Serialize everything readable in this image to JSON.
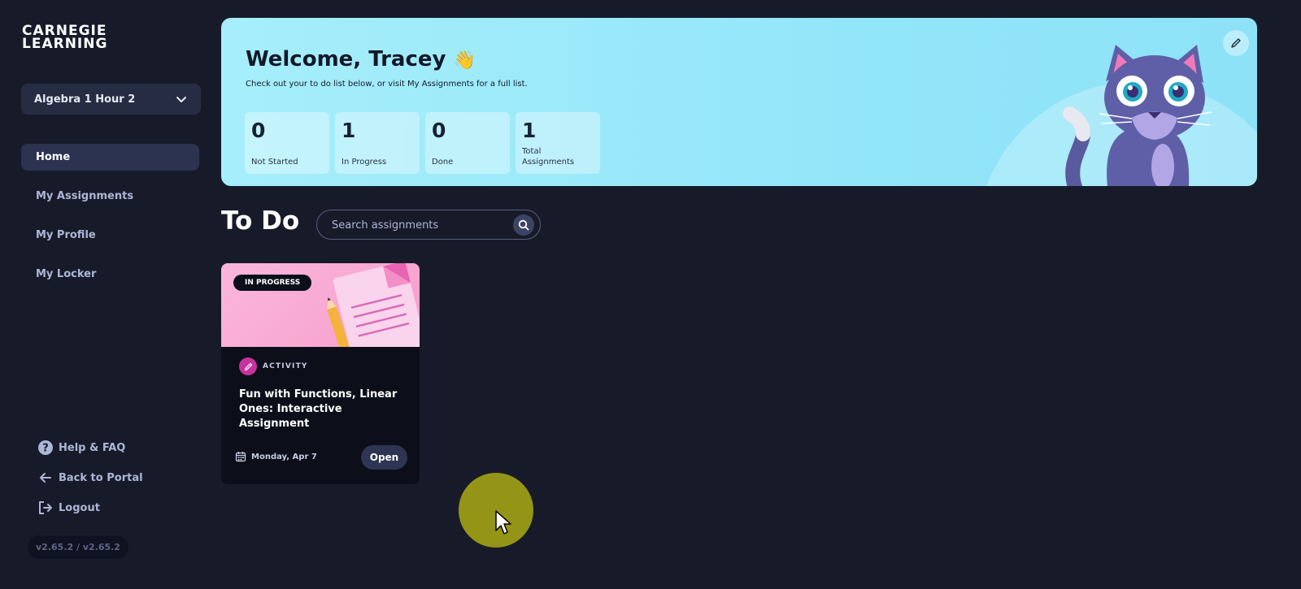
{
  "brand": {
    "line1": "CARNEGIE",
    "line2": "LEARNING"
  },
  "class_selector": {
    "value": "Algebra 1 Hour 2",
    "icon": "chevron-down-icon"
  },
  "nav": {
    "items": [
      {
        "label": "Home",
        "active": true
      },
      {
        "label": "My Assignments",
        "active": false
      },
      {
        "label": "My Profile",
        "active": false
      },
      {
        "label": "My Locker",
        "active": false
      }
    ]
  },
  "footer_links": {
    "help": {
      "label": "Help & FAQ",
      "icon": "question-icon"
    },
    "portal": {
      "label": "Back to Portal",
      "icon": "arrow-left-icon"
    },
    "logout": {
      "label": "Logout",
      "icon": "logout-icon"
    }
  },
  "version": "v2.65.2 / v2.65.2",
  "banner": {
    "greeting": "Welcome, Tracey",
    "wave_emoji": "👋",
    "subtitle": "Check out your to do list below, or visit My Assignments for a full list.",
    "stats": [
      {
        "value": "0",
        "label": "Not Started"
      },
      {
        "value": "1",
        "label": "In Progress"
      },
      {
        "value": "0",
        "label": "Done"
      },
      {
        "value": "1",
        "label": "Total Assignments"
      }
    ],
    "edit_icon": "pencil-icon"
  },
  "todo": {
    "title": "To Do",
    "search_placeholder": "Search assignments",
    "search_icon": "search-icon"
  },
  "cards": [
    {
      "status": "IN PROGRESS",
      "type": "ACTIVITY",
      "title": "Fun with Functions, Linear Ones: Interactive Assignment",
      "due": "Monday, Apr 7",
      "button": "Open"
    }
  ],
  "colors": {
    "background": "#171b29",
    "banner": "#a6eefb",
    "nav_active": "#2b3350",
    "card_image": "#fbb6dc",
    "activity_icon": "#c7339e"
  }
}
